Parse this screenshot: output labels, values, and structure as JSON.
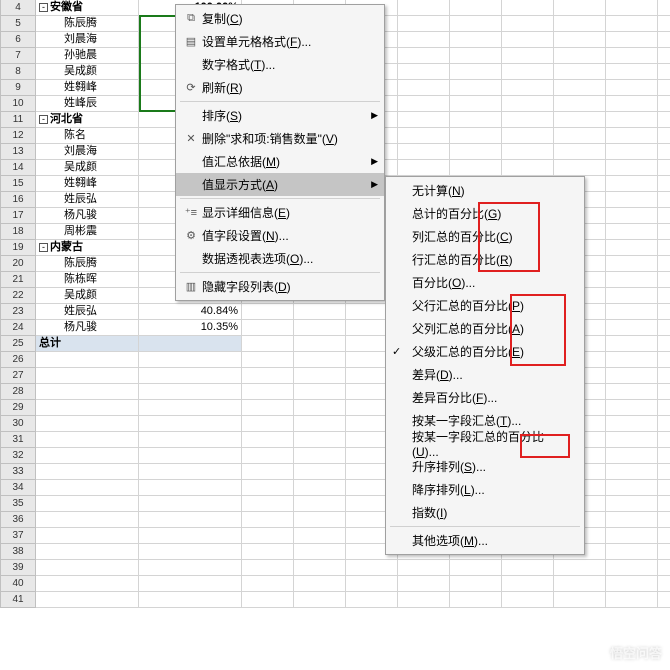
{
  "rows": [
    {
      "n": 4,
      "a": "安徽省",
      "b": "100.00%",
      "group": true,
      "bold": true
    },
    {
      "n": 5,
      "a": "陈辰腾",
      "b": ""
    },
    {
      "n": 6,
      "a": "刘晨海",
      "b": ""
    },
    {
      "n": 7,
      "a": "孙驰晨",
      "b": ""
    },
    {
      "n": 8,
      "a": "吴成颜",
      "b": ""
    },
    {
      "n": 9,
      "a": "姓翱峰",
      "b": ""
    },
    {
      "n": 10,
      "a": "姓峰辰",
      "b": ""
    },
    {
      "n": 11,
      "a": "河北省",
      "b": "",
      "group": true,
      "bold": true
    },
    {
      "n": 12,
      "a": "陈名",
      "b": ""
    },
    {
      "n": 13,
      "a": "刘晨海",
      "b": ""
    },
    {
      "n": 14,
      "a": "吴成颜",
      "b": ""
    },
    {
      "n": 15,
      "a": "姓翱峰",
      "b": ""
    },
    {
      "n": 16,
      "a": "姓辰弘",
      "b": ""
    },
    {
      "n": 17,
      "a": "杨凡骏",
      "b": ""
    },
    {
      "n": 18,
      "a": "周彬震",
      "b": ""
    },
    {
      "n": 19,
      "a": "内蒙古",
      "b": "",
      "group": true,
      "bold": true
    },
    {
      "n": 20,
      "a": "陈辰腾",
      "b": ""
    },
    {
      "n": 21,
      "a": "陈栋晖",
      "b": ""
    },
    {
      "n": 22,
      "a": "吴成颜",
      "b": ""
    },
    {
      "n": 23,
      "a": "姓辰弘",
      "b": "40.84%"
    },
    {
      "n": 24,
      "a": "杨凡骏",
      "b": "10.35%"
    },
    {
      "n": 25,
      "a": "总计",
      "b": "",
      "total": true
    },
    {
      "n": 26
    },
    {
      "n": 27
    },
    {
      "n": 28
    },
    {
      "n": 29
    },
    {
      "n": 30
    },
    {
      "n": 31
    },
    {
      "n": 32
    },
    {
      "n": 33
    },
    {
      "n": 34
    },
    {
      "n": 35
    },
    {
      "n": 36
    },
    {
      "n": 37
    },
    {
      "n": 38
    },
    {
      "n": 39
    },
    {
      "n": 40
    },
    {
      "n": 41
    }
  ],
  "menu1": [
    {
      "icon": "copy",
      "label": "复制(C)"
    },
    {
      "icon": "format",
      "label": "设置单元格格式(F)..."
    },
    {
      "icon": "",
      "label": "数字格式(T)..."
    },
    {
      "icon": "refresh",
      "label": "刷新(R)"
    },
    {
      "icon": "",
      "label": "排序(S)",
      "arrow": true
    },
    {
      "icon": "x",
      "label": "删除\"求和项:销售数量\"(V)"
    },
    {
      "icon": "",
      "label": "值汇总依据(M)",
      "arrow": true
    },
    {
      "icon": "",
      "label": "值显示方式(A)",
      "arrow": true,
      "hl": true
    },
    {
      "icon": "expand",
      "label": "显示详细信息(E)"
    },
    {
      "icon": "settings",
      "label": "值字段设置(N)..."
    },
    {
      "icon": "",
      "label": "数据透视表选项(O)..."
    },
    {
      "icon": "hide",
      "label": "隐藏字段列表(D)"
    }
  ],
  "menu2": [
    {
      "label": "无计算(N)"
    },
    {
      "label": "总计的百分比(G)"
    },
    {
      "label": "列汇总的百分比(C)"
    },
    {
      "label": "行汇总的百分比(R)"
    },
    {
      "label": "百分比(O)..."
    },
    {
      "label": "父行汇总的百分比(P)"
    },
    {
      "label": "父列汇总的百分比(A)"
    },
    {
      "label": "父级汇总的百分比(E)",
      "check": true
    },
    {
      "label": "差异(D)..."
    },
    {
      "label": "差异百分比(F)..."
    },
    {
      "label": "按某一字段汇总(T)..."
    },
    {
      "label": "按某一字段汇总的百分比(U)..."
    },
    {
      "label": "升序排列(S)..."
    },
    {
      "label": "降序排列(L)..."
    },
    {
      "label": "指数(I)"
    },
    {
      "label": "其他选项(M)..."
    }
  ],
  "watermark": "悟空问答"
}
